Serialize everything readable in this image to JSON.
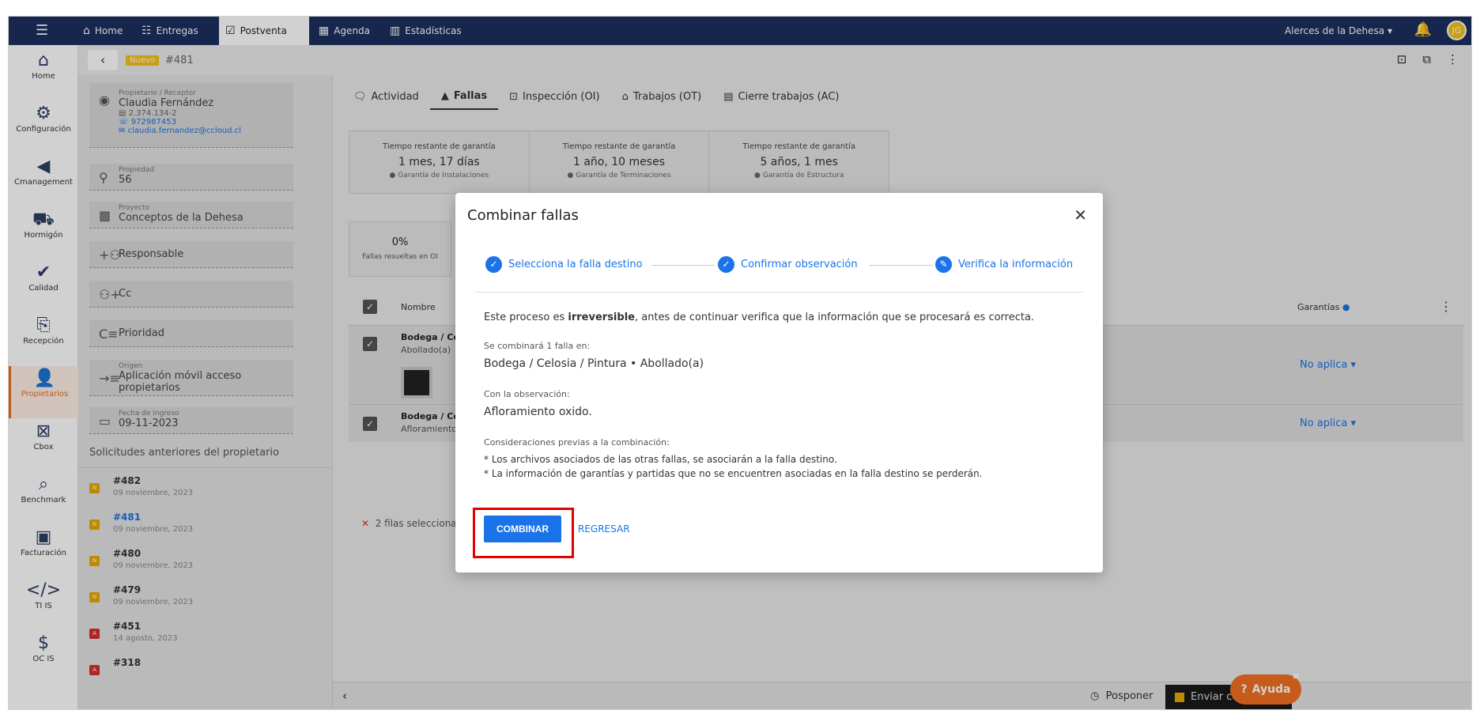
{
  "topnav": {
    "items": [
      {
        "label": "Home",
        "icon": "home-icon"
      },
      {
        "label": "Entregas",
        "icon": "list-icon"
      },
      {
        "label": "Postventa",
        "icon": "checklist-icon"
      },
      {
        "label": "Agenda",
        "icon": "calendar-icon"
      },
      {
        "label": "Estadísticas",
        "icon": "stats-icon"
      }
    ],
    "project": "Alerces de la Dehesa",
    "avatar": "JG"
  },
  "rail": [
    "Home",
    "Configuración",
    "Cmanagement",
    "Hormigón",
    "Calidad",
    "Recepción",
    "Propietarios",
    "Cbox",
    "Benchmark",
    "Facturación",
    "TI IS",
    "OC IS"
  ],
  "subheader": {
    "badge": "Nuevo",
    "id": "#481"
  },
  "owner": {
    "label": "Propietario / Receptor",
    "name": "Claudia Fernández",
    "rut": "2.374.134-2",
    "phone": "972987453",
    "email": "claudia.fernandez@ccloud.cl",
    "prop_label": "Propiedad",
    "prop": "56",
    "proj_label": "Proyecto",
    "proj": "Conceptos de la Dehesa",
    "responsable": "Responsable",
    "cc": "Cc",
    "prioridad": "Prioridad",
    "origen_label": "Origen",
    "origen": "Aplicación móvil acceso propietarios",
    "fecha_label": "Fecha de ingreso",
    "fecha": "09-11-2023"
  },
  "previous": {
    "title": "Solicitudes anteriores del propietario",
    "items": [
      {
        "id": "#482",
        "date": "09 noviembre, 2023",
        "badge": "N"
      },
      {
        "id": "#481",
        "date": "09 noviembre, 2023",
        "badge": "N"
      },
      {
        "id": "#480",
        "date": "09 noviembre, 2023",
        "badge": "N"
      },
      {
        "id": "#479",
        "date": "09 noviembre, 2023",
        "badge": "N"
      },
      {
        "id": "#451",
        "date": "14 agosto, 2023",
        "badge": "A"
      },
      {
        "id": "#318",
        "date": "",
        "badge": "A"
      }
    ]
  },
  "tabs": [
    "Actividad",
    "Fallas",
    "Inspección (OI)",
    "Trabajos (OT)",
    "Cierre trabajos (AC)"
  ],
  "warranty": [
    {
      "title": "Tiempo restante de garantía",
      "value": "1 mes, 17 días",
      "sub": "Garantía de Instalaciones"
    },
    {
      "title": "Tiempo restante de garantía",
      "value": "1 año, 10 meses",
      "sub": "Garantía de Terminaciones"
    },
    {
      "title": "Tiempo restante de garantía",
      "value": "5 años, 1 mes",
      "sub": "Garantía de Estructura"
    }
  ],
  "pct": {
    "value": "0%",
    "label": "Fallas resueltas en OI"
  },
  "table": {
    "col_name": "Nombre",
    "col_warranty": "Garantías",
    "rows": [
      {
        "name": "Bodega / Celos",
        "sub": "Abollado(a)",
        "warranty": "No aplica"
      },
      {
        "name": "Bodega / Celos",
        "sub": "Afloramiento ox",
        "warranty": "No aplica"
      }
    ],
    "selected": "2 filas seleccionadas"
  },
  "bottom": {
    "posponer": "Posponer",
    "enviar": "Enviar co",
    "ayuda": "Ayuda"
  },
  "modal": {
    "title": "Combinar fallas",
    "steps": [
      "Selecciona la falla destino",
      "Confirmar observación",
      "Verifica la información"
    ],
    "intro_pre": "Este proceso es ",
    "intro_bold": "irreversible",
    "intro_post": ", antes de continuar verifica que la información que se procesará es correcta.",
    "combine_label": "Se combinará 1 falla en:",
    "combine_value": "Bodega / Celosia / Pintura • Abollado(a)",
    "obs_label": "Con la observación:",
    "obs_value": "Afloramiento oxido.",
    "cons_label": "Consideraciones previas a la combinación:",
    "cons_1": "* Los archivos asociados de las otras fallas, se asociarán a la falla destino.",
    "cons_2": "* La información de garantías y partidas que no se encuentren asociadas en la falla destino se perderán.",
    "btn_combinar": "COMBINAR",
    "btn_regresar": "REGRESAR"
  }
}
